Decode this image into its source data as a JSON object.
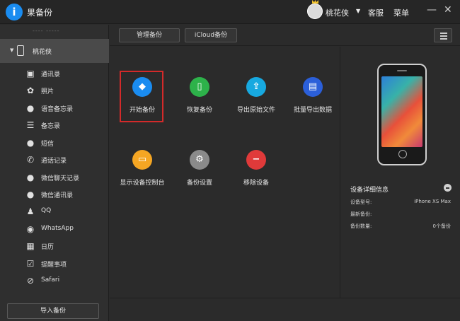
{
  "app": {
    "title": "果备份"
  },
  "user": {
    "name": "桃花侠"
  },
  "titlebar": {
    "service": "客服",
    "menu": "菜单",
    "minimize": "—",
    "close": "✕"
  },
  "sidebar": {
    "faded_text": "---- -----",
    "device_name": "桃花侠",
    "items": [
      {
        "label": "通讯录",
        "icon": "contacts-icon"
      },
      {
        "label": "照片",
        "icon": "photos-icon"
      },
      {
        "label": "语音备忘录",
        "icon": "microphone-icon"
      },
      {
        "label": "备忘录",
        "icon": "notes-icon"
      },
      {
        "label": "短信",
        "icon": "message-icon"
      },
      {
        "label": "通话记录",
        "icon": "phone-call-icon"
      },
      {
        "label": "微信聊天记录",
        "icon": "wechat-icon"
      },
      {
        "label": "微信通讯录",
        "icon": "wechat-contacts-icon"
      },
      {
        "label": "QQ",
        "icon": "qq-icon"
      },
      {
        "label": "WhatsApp",
        "icon": "whatsapp-icon"
      },
      {
        "label": "日历",
        "icon": "calendar-icon"
      },
      {
        "label": "提醒事项",
        "icon": "reminder-icon"
      },
      {
        "label": "Safari",
        "icon": "safari-icon"
      }
    ],
    "import_label": "导入备份"
  },
  "tabs": {
    "manage": "管理备份",
    "icloud": "iCloud备份"
  },
  "features": [
    {
      "label": "开始备份",
      "icon": "layers-icon",
      "color": "#1a8cf0"
    },
    {
      "label": "恢复备份",
      "icon": "phone-restore-icon",
      "color": "#2db24a"
    },
    {
      "label": "导出原始文件",
      "icon": "export-icon",
      "color": "#17a9e0"
    },
    {
      "label": "批量导出数据",
      "icon": "batch-export-icon",
      "color": "#2b5fd9"
    },
    {
      "label": "显示设备控制台",
      "icon": "console-icon",
      "color": "#f5a623"
    },
    {
      "label": "备份设置",
      "icon": "gear-icon",
      "color": "#8a8a8a"
    },
    {
      "label": "移除设备",
      "icon": "remove-icon",
      "color": "#e03a3a"
    }
  ],
  "details": {
    "title": "设备详细信息",
    "rows": [
      {
        "label": "设备型号:",
        "value": "iPhone XS Max"
      },
      {
        "label": "最新备份:",
        "value": ""
      },
      {
        "label": "备份数量:",
        "value": "0个备份"
      }
    ]
  }
}
